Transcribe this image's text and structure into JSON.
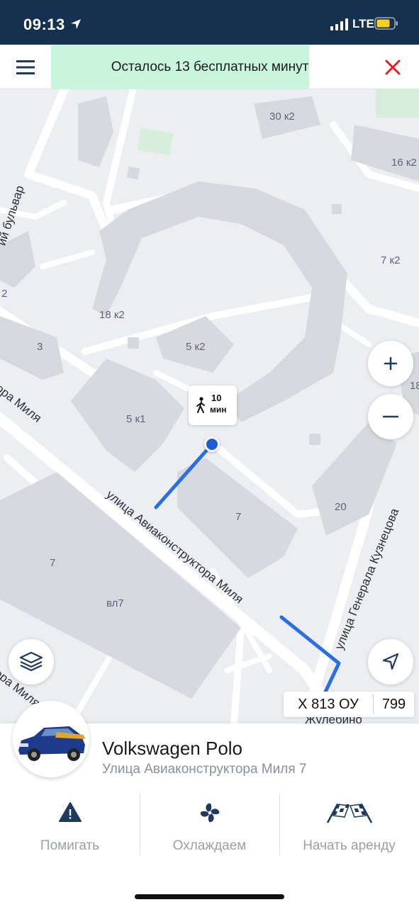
{
  "status_bar": {
    "time": "09:13",
    "network": "LTE"
  },
  "banner": {
    "text": "Осталось 13 бесплатных минут",
    "background": "#c9f5dc"
  },
  "map": {
    "building_labels": [
      "30 к2",
      "16 к2",
      "7 к2",
      "18 к2",
      "5 к2",
      "5 к1",
      "3",
      "2",
      "7",
      "20",
      "7",
      "вл7",
      "18"
    ],
    "street_labels": [
      "улица Авиаконструктора Миля",
      "улица Генерала Кузнецова",
      "ий бульвар",
      "ора Миля",
      "ора Миля",
      "Жулебино"
    ],
    "walk_time": {
      "value": "10",
      "unit": "мин"
    },
    "route_color": "#2a6fe0",
    "zoom_in": "+",
    "zoom_out": "−"
  },
  "car": {
    "model": "Volkswagen Polo",
    "address": "Улица Авиаконструктора Миля 7",
    "plate_number": "Х 813 ОУ",
    "plate_region": "799"
  },
  "actions": [
    {
      "label": "Помигать",
      "icon": "warning-icon"
    },
    {
      "label": "Охлаждаем",
      "icon": "fan-icon"
    },
    {
      "label": "Начать аренду",
      "icon": "checkered-flags-icon"
    }
  ],
  "colors": {
    "status_bar": "#16314f",
    "close": "#e02020",
    "user_dot": "#1e5bd8",
    "action_icon": "#1f3a5f"
  }
}
